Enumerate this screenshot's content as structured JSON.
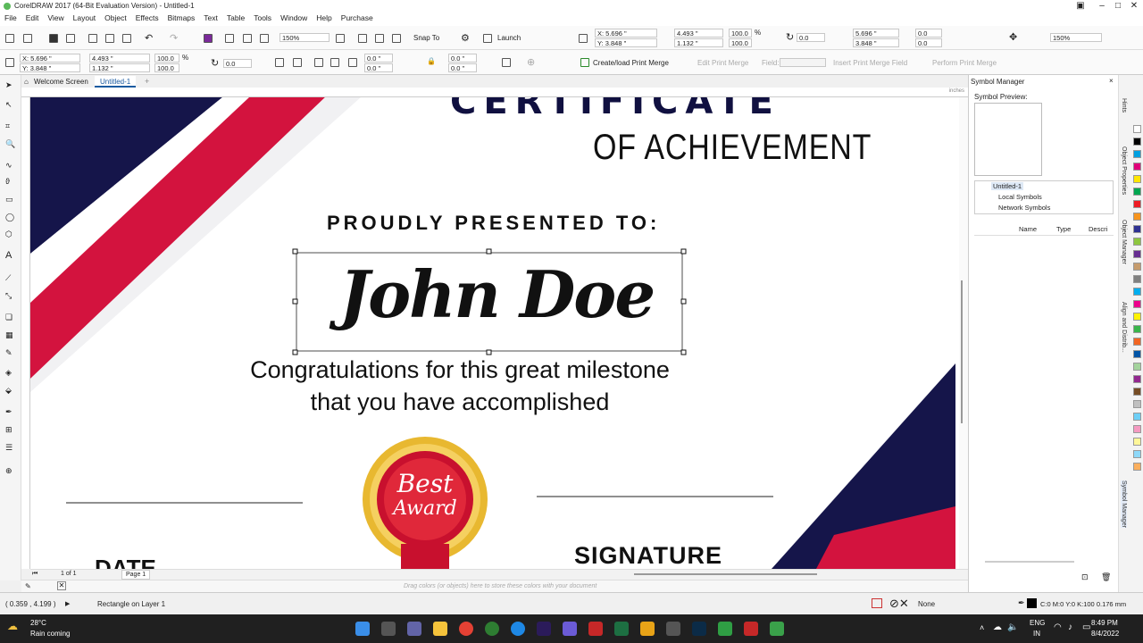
{
  "window": {
    "title": "CorelDRAW 2017 (64-Bit Evaluation Version) - Untitled-1"
  },
  "menu": [
    "File",
    "Edit",
    "View",
    "Layout",
    "Object",
    "Effects",
    "Bitmaps",
    "Text",
    "Table",
    "Tools",
    "Window",
    "Help",
    "Purchase"
  ],
  "toolbar1": {
    "zoom": "150%",
    "snap_to": "Snap To",
    "launch": "Launch",
    "x": "X: 5.696 \"",
    "y": "Y: 3.848 \"",
    "w": "4.493 \"",
    "h": "1.132 \"",
    "sx": "100.0",
    "sy": "100.0",
    "pct": "%",
    "angle": "0.0",
    "x2": "5.696 \"",
    "y2": "3.848 \"",
    "z1": "0.0",
    "z2": "0.0",
    "zoom2": "150%"
  },
  "toolbar2": {
    "x": "X: 5.696 \"",
    "y": "Y: 3.848 \"",
    "w": "4.493 \"",
    "h": "1.132 \"",
    "sx": "100.0",
    "sy": "100.0",
    "pct": "%",
    "angle": "0.0",
    "c1": "0.0 \"",
    "c2": "0.0 \"",
    "c3": "0.0 \"",
    "c4": "0.0 \"",
    "print_merge": "Create/load Print Merge",
    "edit_merge": "Edit Print Merge",
    "field": "Field:",
    "insert_field": "Insert Print Merge Field",
    "perform_merge": "Perform Print Merge"
  },
  "tabs": [
    "Welcome Screen",
    "Untitled-1"
  ],
  "ruler_units": "inches",
  "certificate": {
    "heading_partial": "CERTIFICATE",
    "subheading": "OF ACHIEVEMENT",
    "presented": "PROUDLY PRESENTED TO:",
    "name": "John Doe",
    "message_line1": "Congratulations for this great milestone",
    "message_line2": "that you have accomplished",
    "award_line1": "Best",
    "award_line2": "Award",
    "date": "DATE",
    "signature": "SIGNATURE"
  },
  "page_nav": {
    "count": "1 of 1",
    "page": "Page 1"
  },
  "palette_hint": "Drag colors (or objects) here to store these colors with your document",
  "docker": {
    "title": "Symbol Manager",
    "preview_label": "Symbol Preview:",
    "tree": [
      "Untitled-1",
      "Local Symbols",
      "Network Symbols"
    ],
    "columns": [
      "Name",
      "Type",
      "Descri"
    ]
  },
  "docker_tabs": [
    "Hints",
    "Object Properties",
    "Object Manager",
    "Align and Distrib...",
    "Symbol Manager"
  ],
  "palette_colors": [
    "#ffffff",
    "#000000",
    "#00a0e0",
    "#e0007a",
    "#ffe600",
    "#00a650",
    "#ed1c24",
    "#f7941d",
    "#2e3192",
    "#8dc63f",
    "#662d91",
    "#c69c6d",
    "#808080",
    "#00aeef",
    "#ec008c",
    "#fff200",
    "#39b54a",
    "#f26522",
    "#0054a6",
    "#a3d39c",
    "#92278f",
    "#754c24",
    "#c0c0c0",
    "#6dcff6",
    "#f49ac1",
    "#fff799",
    "#8ed8f8",
    "#fbaf5d"
  ],
  "status": {
    "coords": "( 0.359 , 4.199 )",
    "info": "Rectangle on Layer 1",
    "fill": "None",
    "outline": "C:0 M:0 Y:0 K:100  0.176 mm"
  },
  "taskbar": {
    "weather_temp": "28°C",
    "weather_text": "Rain coming",
    "lang1": "ENG",
    "lang2": "IN",
    "time": "8:49 PM",
    "date": "8/4/2022"
  }
}
